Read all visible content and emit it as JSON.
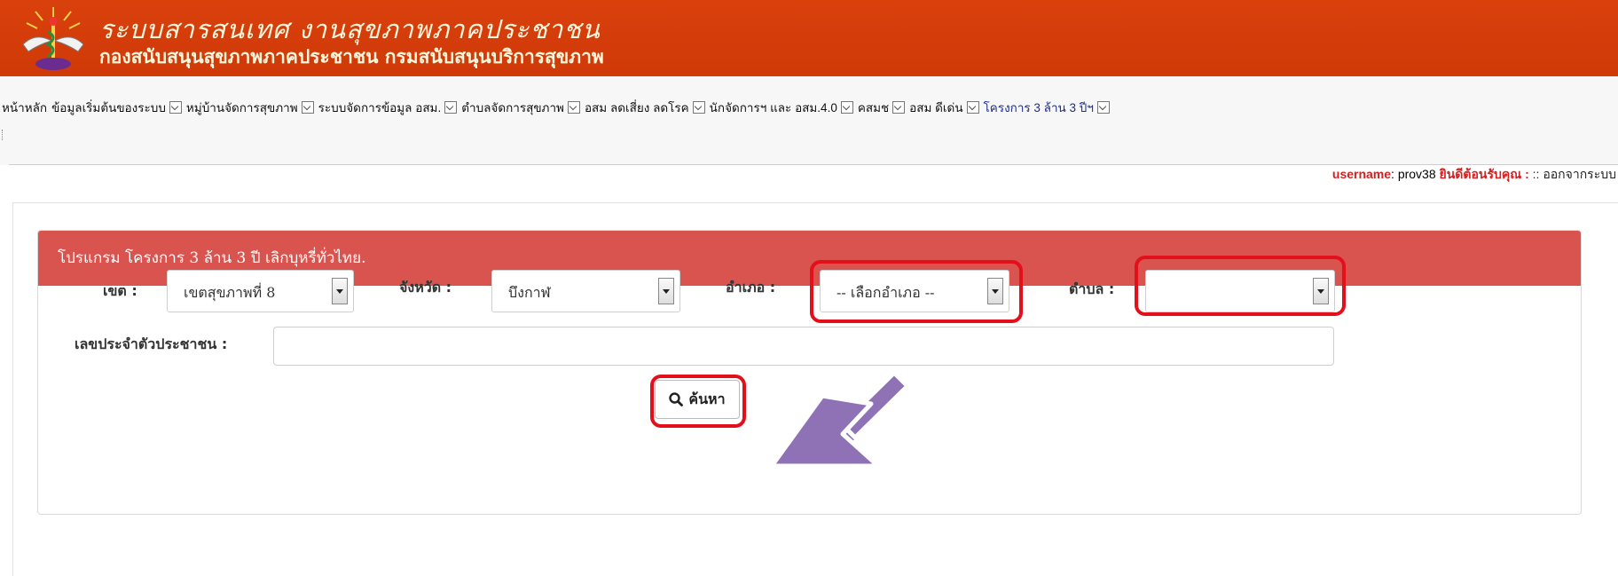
{
  "header": {
    "title": "ระบบสารสนเทศ งานสุขภาพภาคประชาชน",
    "subtitle": "กองสนับสนุนสุขภาพภาคประชาชน กรมสนับสนุนบริการสุขภาพ"
  },
  "nav": {
    "items": [
      {
        "label": "หน้าหลัก",
        "dropdown": false
      },
      {
        "label": "ข้อมูลเริ่มต้นของระบบ",
        "dropdown": true
      },
      {
        "label": "หมู่บ้านจัดการสุขภาพ",
        "dropdown": true
      },
      {
        "label": "ระบบจัดการข้อมูล อสม.",
        "dropdown": true
      },
      {
        "label": "ตำบลจัดการสุขภาพ",
        "dropdown": true
      },
      {
        "label": "อสม ลดเสี่ยง ลดโรค",
        "dropdown": true
      },
      {
        "label": "นักจัดการฯ และ อสม.4.0",
        "dropdown": true
      },
      {
        "label": "คสมช",
        "dropdown": true
      },
      {
        "label": "อสม ดีเด่น",
        "dropdown": true
      },
      {
        "label": "โครงการ 3 ล้าน 3 ปีฯ",
        "dropdown": true,
        "active": true
      }
    ],
    "active_color": "#1a2e8f"
  },
  "user": {
    "label": "username",
    "name": ": prov38 ",
    "welcome": "ยินดีต้อนรับคุณ :",
    "sep": " :: ",
    "logout": "ออกจากระบบ"
  },
  "panel": {
    "title": "โปรแกรม โครงการ 3 ล้าน 3 ปี เลิกบุหรี่ทั่วไทย.",
    "header_color": "#d9534f"
  },
  "form": {
    "zone_label": "เขต :",
    "zone_value": "เขตสุขภาพที่ 8",
    "province_label": "จังหวัด :",
    "province_value": "บึงกาฬ",
    "district_label": "อำเภอ :",
    "district_value": "-- เลือกอำเภอ --",
    "subdistrict_label": "ตำบล :",
    "subdistrict_value": "",
    "id_label": "เลขประจำตัวประชาชน :",
    "id_value": "",
    "search_label": "ค้นหา"
  },
  "annotation": {
    "highlight_color": "#e3101c",
    "arrow_color": "#8e72b5"
  }
}
